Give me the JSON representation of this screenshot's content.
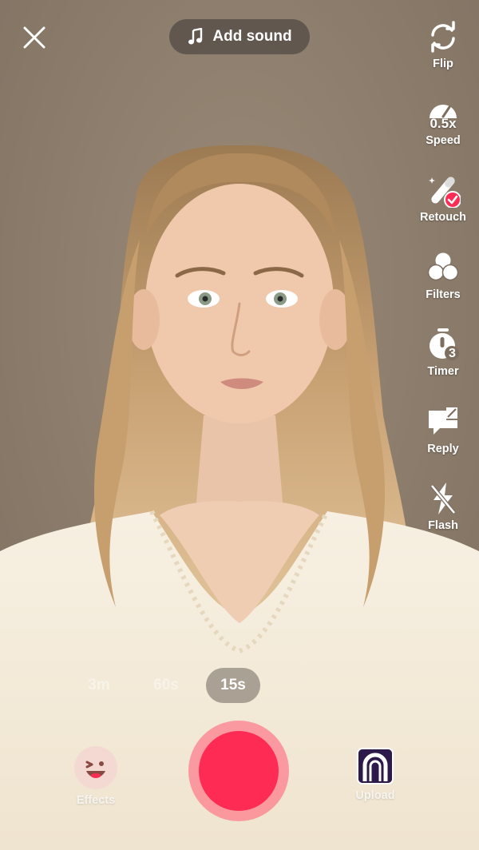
{
  "top_bar": {
    "close_icon": "close-icon",
    "add_sound_label": "Add sound",
    "add_sound_icon": "music-note-icon"
  },
  "tools": [
    {
      "label": "Flip",
      "icon": "flip-camera-icon"
    },
    {
      "label": "Speed",
      "icon": "speed-icon",
      "value": "0.5x"
    },
    {
      "label": "Retouch",
      "icon": "retouch-wand-icon",
      "status": "enabled",
      "badge_color": "#fe2c55"
    },
    {
      "label": "Filters",
      "icon": "filters-icon"
    },
    {
      "label": "Timer",
      "icon": "timer-icon",
      "value": "3"
    },
    {
      "label": "Reply",
      "icon": "reply-icon"
    },
    {
      "label": "Flash",
      "icon": "flash-off-icon"
    }
  ],
  "durations": {
    "items": [
      "3m",
      "60s",
      "15s"
    ],
    "selected": "15s"
  },
  "bottom": {
    "effects_label": "Effects",
    "effects_icon": "effects-face-icon",
    "upload_label": "Upload",
    "upload_icon": "gallery-thumbnail-icon",
    "record_color": "#fe2c55"
  }
}
